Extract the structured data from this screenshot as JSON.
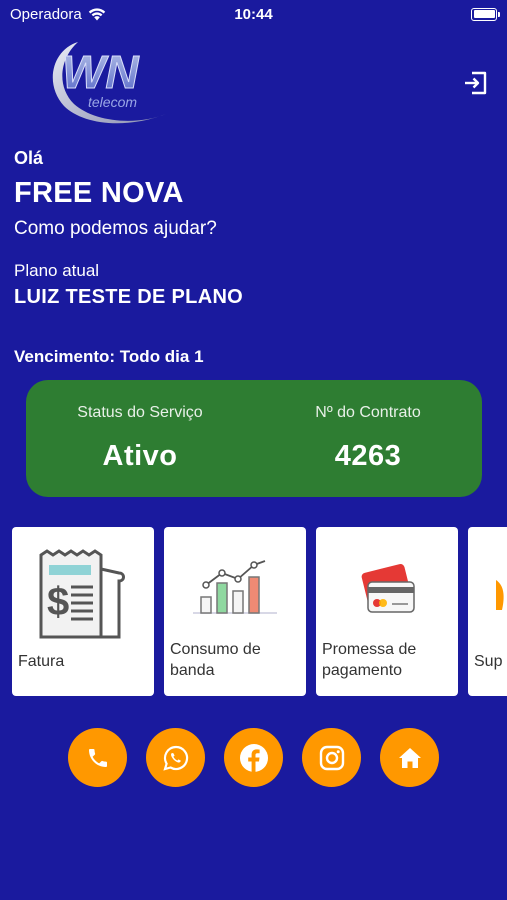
{
  "status_bar": {
    "carrier": "Operadora",
    "time": "10:44"
  },
  "header": {
    "logo_text": "WN",
    "logo_subtext": "telecom"
  },
  "greeting": {
    "hello": "Olá",
    "name": "FREE NOVA",
    "question": "Como podemos ajudar?"
  },
  "plan": {
    "label": "Plano atual",
    "name": "LUIZ TESTE DE PLANO",
    "due": "Vencimento: Todo dia 1"
  },
  "service": {
    "status_label": "Status do Serviço",
    "status_value": "Ativo",
    "contract_label": "Nº do Contrato",
    "contract_value": "4263",
    "card_color": "#2e7d32"
  },
  "cards": [
    {
      "label": "Fatura",
      "icon": "invoice-icon"
    },
    {
      "label": "Consumo de banda",
      "icon": "bandwidth-chart-icon"
    },
    {
      "label": "Promessa de pagamento",
      "icon": "credit-card-icon"
    },
    {
      "label": "Sup",
      "icon": "support-icon"
    }
  ],
  "social": [
    {
      "icon": "phone-icon"
    },
    {
      "icon": "whatsapp-icon"
    },
    {
      "icon": "facebook-icon"
    },
    {
      "icon": "instagram-icon"
    },
    {
      "icon": "home-icon"
    }
  ],
  "colors": {
    "background": "#1a1a9e",
    "accent": "#ff9800",
    "card": "#ffffff"
  }
}
